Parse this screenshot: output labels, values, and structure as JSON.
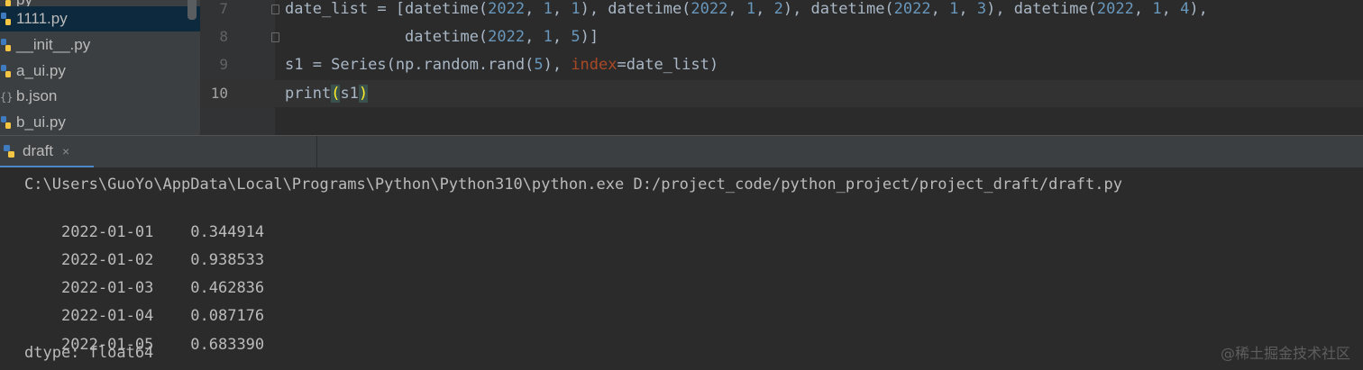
{
  "sidebar": {
    "files": [
      {
        "name": "py",
        "selected": false
      },
      {
        "name": "1111.py",
        "selected": true
      },
      {
        "name": "__init__.py",
        "selected": false
      },
      {
        "name": "a_ui.py",
        "selected": false
      },
      {
        "name": "b.json",
        "selected": false
      },
      {
        "name": "b_ui.py",
        "selected": false
      }
    ]
  },
  "editor": {
    "line_numbers": [
      "7",
      "8",
      "9",
      "10"
    ],
    "lines": [
      "date_list = [datetime(2022, 1, 1), datetime(2022, 1, 2), datetime(2022, 1, 3), datetime(2022, 1, 4),",
      "             datetime(2022, 1, 5)]",
      "s1 = Series(np.random.rand(5), index=date_list)",
      "print(s1)"
    ]
  },
  "run_panel": {
    "tab_label": "draft",
    "close_label": "×",
    "command": "C:\\Users\\GuoYo\\AppData\\Local\\Programs\\Python\\Python310\\python.exe D:/project_code/python_project/project_draft/draft.py",
    "output_rows": [
      {
        "date": "2022-01-01",
        "value": "0.344914"
      },
      {
        "date": "2022-01-02",
        "value": "0.938533"
      },
      {
        "date": "2022-01-03",
        "value": "0.462836"
      },
      {
        "date": "2022-01-04",
        "value": "0.087176"
      },
      {
        "date": "2022-01-05",
        "value": "0.683390"
      }
    ],
    "dtype_line": "dtype: float64"
  },
  "watermark": "@稀土掘金技术社区",
  "colors": {
    "number": "#6897bb",
    "keyword_arg": "#aa4926",
    "default_text": "#a9b7c6",
    "selection": "#0d293e",
    "tab_underline": "#4a88c7"
  }
}
